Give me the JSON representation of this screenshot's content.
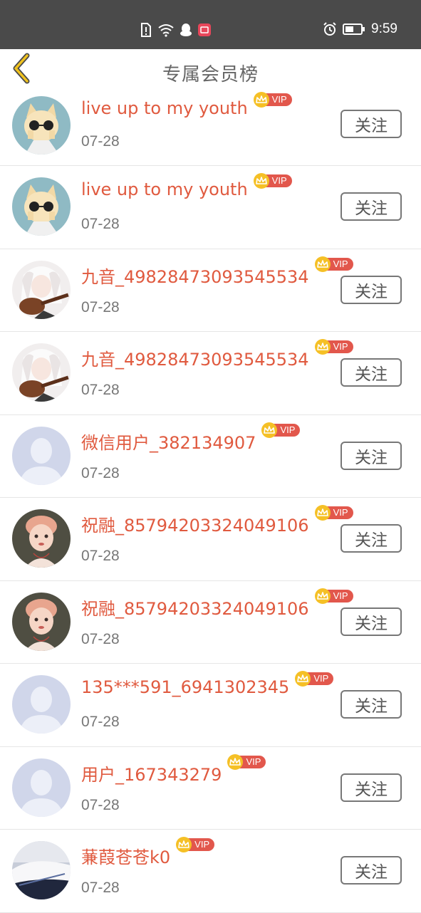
{
  "status_bar": {
    "time": "9:59",
    "icons_left": [
      "sim-alert-icon",
      "wifi-icon",
      "qq-penguin-icon",
      "app-notification-icon"
    ],
    "icons_right": [
      "alarm-icon",
      "battery-icon"
    ]
  },
  "header": {
    "title": "专属会员榜",
    "back_icon": "chevron-left-icon",
    "accent_color": "#f0c21e"
  },
  "colors": {
    "name_color": "#e05a3f",
    "vip_badge": "#e2574c",
    "vip_crown": "#f5c026"
  },
  "vip_label": "VIP",
  "follow_label": "关注",
  "members": [
    {
      "name": "live up to my youth",
      "date": "07-28",
      "avatar": "cat-sunglasses-avatar"
    },
    {
      "name": "live up to my youth",
      "date": "07-28",
      "avatar": "cat-sunglasses-avatar"
    },
    {
      "name": "九音_49828473093545534",
      "date": "07-28",
      "avatar": "anime-guitar-avatar"
    },
    {
      "name": "九音_49828473093545534",
      "date": "07-28",
      "avatar": "anime-guitar-avatar"
    },
    {
      "name": "微信用户_382134907",
      "date": "07-28",
      "avatar": "default-user-avatar"
    },
    {
      "name": "祝融_85794203324049106",
      "date": "07-28",
      "avatar": "doll-portrait-avatar"
    },
    {
      "name": "祝融_85794203324049106",
      "date": "07-28",
      "avatar": "doll-portrait-avatar"
    },
    {
      "name": "135***591_6941302345",
      "date": "07-28",
      "avatar": "default-user-avatar"
    },
    {
      "name": "用户_167343279",
      "date": "07-28",
      "avatar": "default-user-avatar"
    },
    {
      "name": "蒹葭苍苍k0",
      "date": "07-28",
      "avatar": "landscape-photo-avatar"
    }
  ]
}
